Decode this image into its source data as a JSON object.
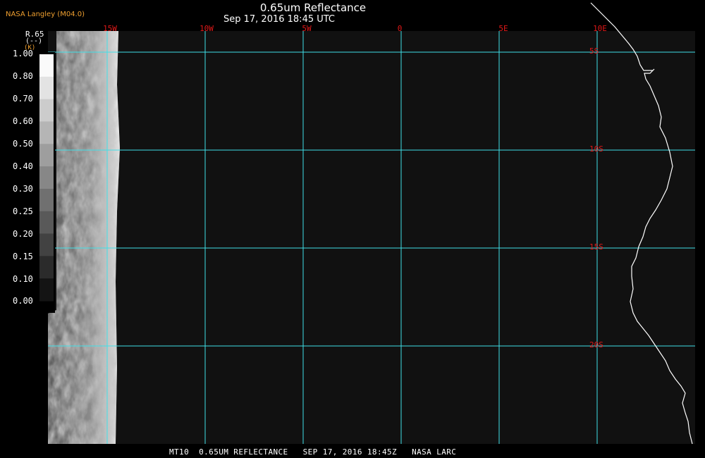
{
  "header": {
    "title": "0.65um Reflectance",
    "subtitle": "Sep 17, 2016 18:45 UTC",
    "producer": "NASA Langley (M04.0)"
  },
  "footer": {
    "caption": "MT10  0.65UM REFLECTANCE   SEP 17, 2016 18:45Z   NASA LARC"
  },
  "map": {
    "background": "#111111",
    "grid_color": "#40e0e8",
    "label_color": "#e01818",
    "coastline_color": "#ffffff",
    "longitude_labels": [
      "15W",
      "10W",
      "5W",
      "0",
      "5E",
      "10E"
    ],
    "latitude_labels": [
      "5S",
      "10S",
      "15S",
      "20S"
    ]
  },
  "colorbar": {
    "name": "R.65",
    "unit": "(--)",
    "symbol": "(K)",
    "ticks": [
      "1.00",
      "0.80",
      "0.70",
      "0.60",
      "0.50",
      "0.40",
      "0.30",
      "0.25",
      "0.20",
      "0.15",
      "0.10",
      "0.00"
    ]
  }
}
